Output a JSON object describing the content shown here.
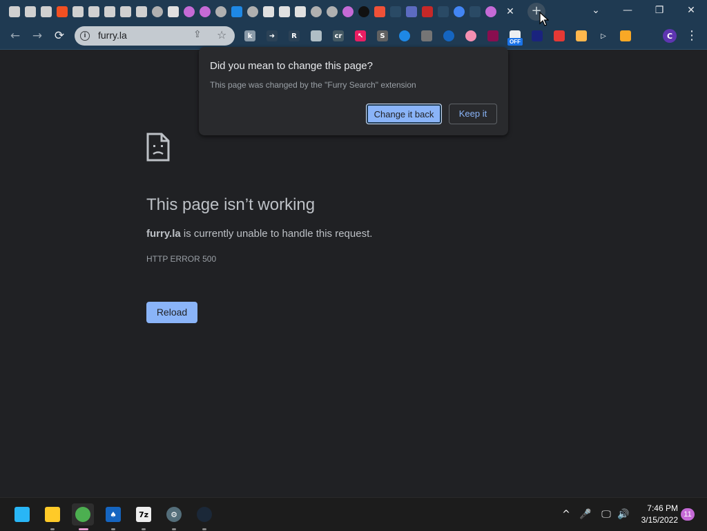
{
  "browser": {
    "tabs": [
      {
        "icon": "furry-site-icon",
        "color": "#d0d0d0"
      },
      {
        "icon": "furry-site-icon",
        "color": "#d0d0d0"
      },
      {
        "icon": "furry-site-icon",
        "color": "#d0d0d0"
      },
      {
        "icon": "microsoft-icon",
        "color": "#f25022"
      },
      {
        "icon": "furry-site-icon",
        "color": "#d0d0d0"
      },
      {
        "icon": "furry-site-icon",
        "color": "#d0d0d0"
      },
      {
        "icon": "furry-site-icon",
        "color": "#d0d0d0"
      },
      {
        "icon": "furry-site-icon",
        "color": "#d0d0d0"
      },
      {
        "icon": "furry-site-icon",
        "color": "#d0d0d0"
      },
      {
        "icon": "globe-icon",
        "color": "#b0b0b0"
      },
      {
        "icon": "hand-icon",
        "color": "#e0e0e0"
      },
      {
        "icon": "pink-circle-icon",
        "color": "#c56ad6"
      },
      {
        "icon": "pink-circle-icon",
        "color": "#c56ad6"
      },
      {
        "icon": "globe-icon",
        "color": "#b0b0b0"
      },
      {
        "icon": "vscode-icon",
        "color": "#1e88e5"
      },
      {
        "icon": "globe-icon",
        "color": "#b0b0b0"
      },
      {
        "icon": "puzzle-icon",
        "color": "#e0e0e0"
      },
      {
        "icon": "gear-icon",
        "color": "#e0e0e0"
      },
      {
        "icon": "flask-icon",
        "color": "#e0e0e0"
      },
      {
        "icon": "globe-icon",
        "color": "#b0b0b0"
      },
      {
        "icon": "globe-icon",
        "color": "#b0b0b0"
      },
      {
        "icon": "pink-circle-icon",
        "color": "#c56ad6"
      },
      {
        "icon": "search-icon",
        "color": "#111111"
      },
      {
        "icon": "swift-icon",
        "color": "#f05138"
      },
      {
        "icon": "blank-tab-icon",
        "color": "#2a4a65"
      },
      {
        "icon": "list-icon",
        "color": "#5c6bc0"
      },
      {
        "icon": "red-puzzle-icon",
        "color": "#c62828"
      },
      {
        "icon": "blank-tab-icon",
        "color": "#2a4a65"
      },
      {
        "icon": "chrome-web-store-icon",
        "color": "#4285f4"
      },
      {
        "icon": "blank-tab-icon",
        "color": "#2a4a65"
      },
      {
        "icon": "pink-circle-icon",
        "color": "#c56ad6"
      }
    ],
    "tab_close_glyph": "✕",
    "new_tab_glyph": "+",
    "window_controls": {
      "tab_search": "⌄",
      "minimize": "—",
      "maximize": "❐",
      "close": "✕"
    }
  },
  "toolbar": {
    "back": "←",
    "forward": "→",
    "reload": "⟳",
    "url": "furry.la",
    "share_glyph": "⇪",
    "star_glyph": "☆",
    "extensions": [
      {
        "icon": "k-extension-icon",
        "text": "k",
        "color": "#8a9aa8"
      },
      {
        "icon": "arrow-extension-icon",
        "text": "➜",
        "color": "#2b4256"
      },
      {
        "icon": "r-extension-icon",
        "text": "R",
        "color": "#2b4256"
      },
      {
        "icon": "sheep-extension-icon",
        "text": "",
        "color": "#b0bec5"
      },
      {
        "icon": "cr-extension-icon",
        "text": "cr",
        "color": "#455a64"
      },
      {
        "icon": "cursor-extension-icon",
        "text": "↖",
        "color": "#e91e63"
      },
      {
        "icon": "s-extension-icon",
        "text": "S",
        "color": "#616161"
      },
      {
        "icon": "edge-extension-icon",
        "text": "",
        "color": "#1e88e5"
      },
      {
        "icon": "script-extension-icon",
        "text": "",
        "color": "#757575"
      },
      {
        "icon": "grid-extension-icon",
        "text": "",
        "color": "#1565c0"
      },
      {
        "icon": "flag-extension-icon",
        "text": "",
        "color": "#f48fb1"
      },
      {
        "icon": "mask-extension-icon",
        "text": "",
        "color": "#880e4f"
      },
      {
        "icon": "off-extension-icon",
        "text": "",
        "color": "#eceff1"
      },
      {
        "icon": "shield-extension-icon",
        "text": "",
        "color": "#1a237e"
      },
      {
        "icon": "window-extension-icon",
        "text": "",
        "color": "#e53935"
      },
      {
        "icon": "cat-extension-icon",
        "text": "",
        "color": "#ffb74d"
      },
      {
        "icon": "play-extension-icon",
        "text": "▷",
        "color": "#1f3a52"
      },
      {
        "icon": "monkey-extension-icon",
        "text": "",
        "color": "#f9a825"
      },
      {
        "icon": "puzzle-icon",
        "text": "",
        "color": "#1f3a52"
      }
    ],
    "off_badge": "OFF",
    "profile_initial": "C",
    "profile_color": "#5e35b1",
    "menu_glyph": "⋮"
  },
  "error_page": {
    "title": "This page isn’t working",
    "domain": "furry.la",
    "description_rest": " is currently unable to handle this request.",
    "error_code": "HTTP ERROR 500",
    "reload_label": "Reload"
  },
  "extension_bubble": {
    "title": "Did you mean to change this page?",
    "message": "This page was changed by the \"Furry Search\" extension",
    "change_back_label": "Change it back",
    "keep_label": "Keep it"
  },
  "taskbar": {
    "apps": [
      {
        "name": "start-icon",
        "color": "#29b6f6",
        "text": "",
        "active": false,
        "open": false
      },
      {
        "name": "file-explorer-icon",
        "color": "#ffca28",
        "text": "",
        "active": false,
        "open": true
      },
      {
        "name": "chrome-icon",
        "color": "#4caf50",
        "text": "",
        "active": true,
        "open": true
      },
      {
        "name": "solitaire-icon",
        "color": "#1565c0",
        "text": "♠",
        "active": false,
        "open": true
      },
      {
        "name": "7zip-icon",
        "color": "#eeeeee",
        "text": "7z",
        "active": false,
        "open": true
      },
      {
        "name": "settings-icon",
        "color": "#546e7a",
        "text": "⚙",
        "active": false,
        "open": true
      },
      {
        "name": "steam-icon",
        "color": "#1b2838",
        "text": "",
        "active": false,
        "open": true
      }
    ],
    "tray": {
      "chevron": "^",
      "mic": "🎤",
      "network": "🖵",
      "volume": "🔊"
    },
    "clock_time": "7:46 PM",
    "clock_date": "3/15/2022",
    "notification_count": "11"
  }
}
